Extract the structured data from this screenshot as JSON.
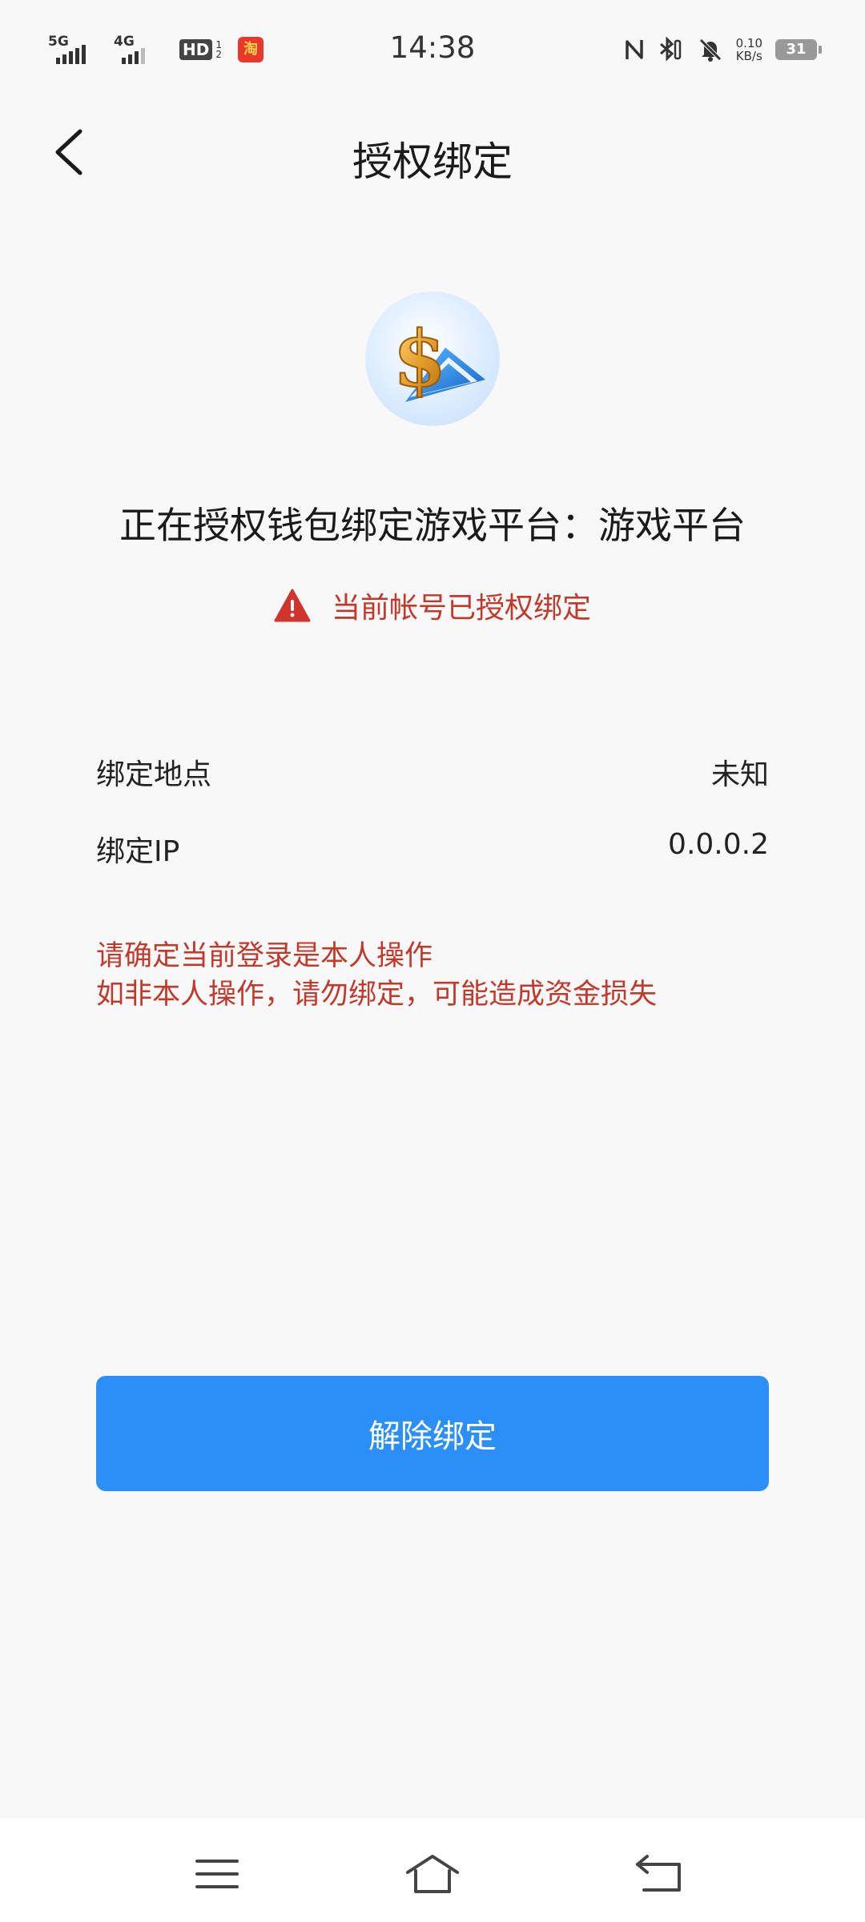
{
  "status_bar": {
    "time": "14:38",
    "network1": "5G",
    "network2": "4G",
    "hd": "HD",
    "hd_sub": [
      "1",
      "2"
    ],
    "app_icon": "淘",
    "speed_value": "0.10",
    "speed_unit": "KB/s",
    "battery": "31",
    "icons": [
      "nfc-icon",
      "bluetooth-icon",
      "mute-bell-icon"
    ]
  },
  "header": {
    "title": "授权绑定",
    "back_icon": "chevron-left-icon"
  },
  "main": {
    "logo_icon": "dollar-coin-logo-icon",
    "auth_message": "正在授权钱包绑定游戏平台：游戏平台",
    "warning_icon": "warning-triangle-icon",
    "warning_text": "当前帐号已授权绑定",
    "details": [
      {
        "label": "绑定地点",
        "value": "未知"
      },
      {
        "label": "绑定IP",
        "value": "0.0.0.2"
      }
    ],
    "notice_lines": [
      "请确定当前登录是本人操作",
      "如非本人操作，请勿绑定，可能造成资金损失"
    ],
    "unbind_button": "解除绑定"
  },
  "nav_bar": {
    "icons": [
      "menu-icon",
      "home-icon",
      "back-icon"
    ]
  },
  "colors": {
    "accent": "#2b8ff7",
    "warning": "#c0392b",
    "background": "#f8f8f8"
  }
}
